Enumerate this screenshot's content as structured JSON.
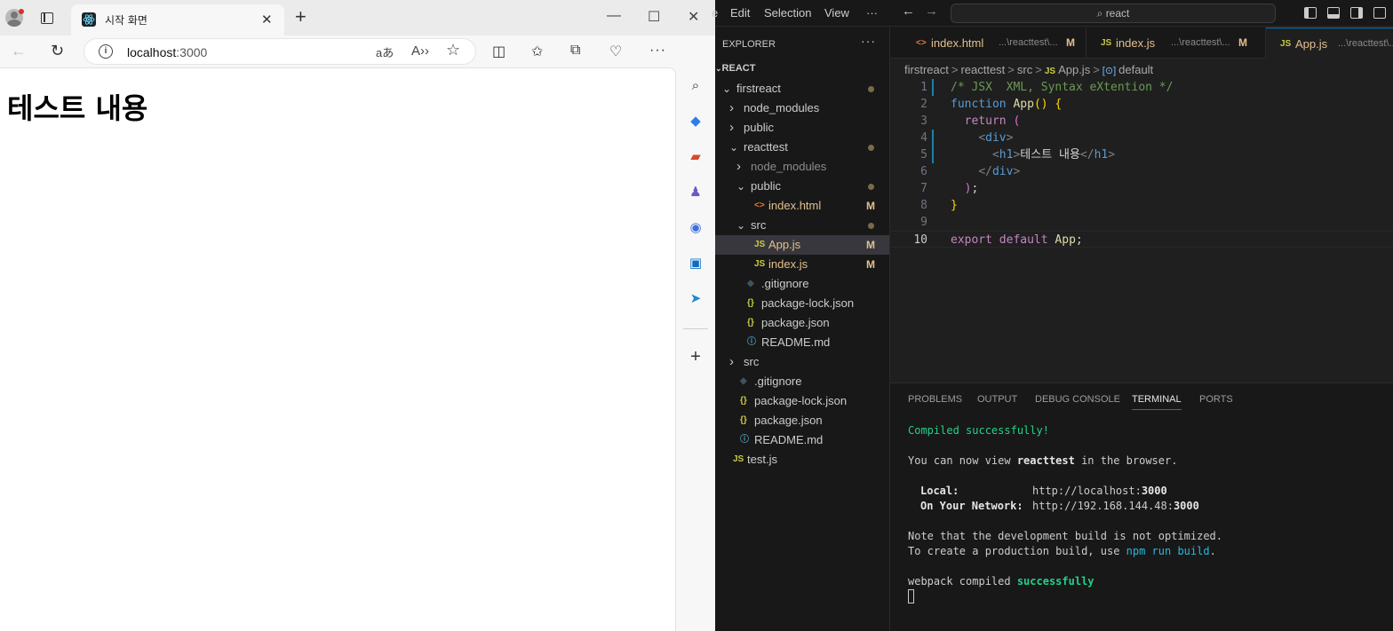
{
  "browser": {
    "tab_title": "시작 화면",
    "url_host": "localhost",
    "url_port": ":3000",
    "page_heading": "테스트 내용",
    "icons": [
      "profile-icon",
      "tab-actions-icon",
      "react-favicon",
      "close-icon",
      "new-tab-icon",
      "minimize-icon",
      "maximize-icon",
      "window-close-icon",
      "back-icon",
      "refresh-icon",
      "site-info-icon",
      "read-aloud-language-icon",
      "immersive-reader-icon",
      "favorite-star-icon",
      "split-screen-icon",
      "favorites-icon",
      "collections-icon",
      "browser-essentials-icon",
      "more-icon",
      "copilot-icon",
      "search-icon",
      "shopping-icon",
      "tools-icon",
      "games-icon",
      "microsoft-365-icon",
      "outlook-icon",
      "drop-icon",
      "add-icon"
    ]
  },
  "vscode": {
    "menu": [
      "e",
      "Edit",
      "Selection",
      "View",
      "···"
    ],
    "command_center": "react",
    "explorer_title": "EXPLORER",
    "explorer_more": "···",
    "section": "REACT",
    "tree": [
      {
        "label": "firstreact",
        "type": "folder-open",
        "depth": 0,
        "dot": true
      },
      {
        "label": "node_modules",
        "type": "folder",
        "depth": 1
      },
      {
        "label": "public",
        "type": "folder",
        "depth": 1
      },
      {
        "label": "reacttest",
        "type": "folder-open",
        "depth": 1,
        "dot": true
      },
      {
        "label": "node_modules",
        "type": "folder",
        "depth": 2,
        "dim": true
      },
      {
        "label": "public",
        "type": "folder-open",
        "depth": 2,
        "dot": true
      },
      {
        "label": "index.html",
        "type": "html",
        "depth": 3,
        "badge": "M"
      },
      {
        "label": "src",
        "type": "folder-open",
        "depth": 2,
        "dot": true
      },
      {
        "label": "App.js",
        "type": "js",
        "depth": 3,
        "badge": "M",
        "selected": true
      },
      {
        "label": "index.js",
        "type": "js",
        "depth": 3,
        "badge": "M"
      },
      {
        "label": ".gitignore",
        "type": "git",
        "depth": 2
      },
      {
        "label": "package-lock.json",
        "type": "json",
        "depth": 2
      },
      {
        "label": "package.json",
        "type": "json",
        "depth": 2
      },
      {
        "label": "README.md",
        "type": "info",
        "depth": 2
      },
      {
        "label": "src",
        "type": "folder",
        "depth": 1
      },
      {
        "label": ".gitignore",
        "type": "git",
        "depth": 1
      },
      {
        "label": "package-lock.json",
        "type": "json",
        "depth": 1
      },
      {
        "label": "package.json",
        "type": "json",
        "depth": 1
      },
      {
        "label": "README.md",
        "type": "info",
        "depth": 1
      },
      {
        "label": "test.js",
        "type": "js",
        "depth": 0
      }
    ],
    "tabs": [
      {
        "icon": "<>",
        "name": "index.html",
        "path": "...\\reacttest\\...",
        "mod": "M",
        "active": false
      },
      {
        "icon": "JS",
        "name": "index.js",
        "path": "...\\reacttest\\...",
        "mod": "M",
        "active": false
      },
      {
        "icon": "JS",
        "name": "App.js",
        "path": "...\\reacttest\\...",
        "mod": "",
        "active": true
      }
    ],
    "breadcrumb": [
      "firstreact",
      ">",
      "reacttest",
      ">",
      "src",
      ">",
      "JS",
      "App.js",
      ">",
      "[⊙]",
      "default"
    ],
    "code": [
      {
        "n": "1",
        "tokens": [
          [
            "/* JSX  XML, Syntax eXtention */",
            "#6a9955"
          ]
        ]
      },
      {
        "n": "2",
        "tokens": [
          [
            "function ",
            "#569cd6"
          ],
          [
            "App",
            "#dcdcaa"
          ],
          [
            "() ",
            "#ffd700"
          ],
          [
            "{",
            "#ffd700"
          ]
        ]
      },
      {
        "n": "3",
        "tokens": [
          [
            "  ",
            "#ccc"
          ],
          [
            "return ",
            "#c586c0"
          ],
          [
            "(",
            "#da70d6"
          ]
        ]
      },
      {
        "n": "4",
        "tokens": [
          [
            "    ",
            "#ccc"
          ],
          [
            "<",
            "#808080"
          ],
          [
            "div",
            "#569cd6"
          ],
          [
            ">",
            "#808080"
          ]
        ]
      },
      {
        "n": "5",
        "tokens": [
          [
            "      ",
            "#ccc"
          ],
          [
            "<",
            "#808080"
          ],
          [
            "h1",
            "#569cd6"
          ],
          [
            ">",
            "#808080"
          ],
          [
            "테스트 내용",
            "#d4d4d4"
          ],
          [
            "</",
            "#808080"
          ],
          [
            "h1",
            "#569cd6"
          ],
          [
            ">",
            "#808080"
          ]
        ]
      },
      {
        "n": "6",
        "tokens": [
          [
            "    ",
            "#ccc"
          ],
          [
            "</",
            "#808080"
          ],
          [
            "div",
            "#569cd6"
          ],
          [
            ">",
            "#808080"
          ]
        ]
      },
      {
        "n": "7",
        "tokens": [
          [
            "  ",
            "#ccc"
          ],
          [
            ")",
            "#da70d6"
          ],
          [
            ";",
            "#d4d4d4"
          ]
        ]
      },
      {
        "n": "8",
        "tokens": [
          [
            "}",
            "#ffd700"
          ]
        ]
      },
      {
        "n": "9",
        "tokens": []
      },
      {
        "n": "10",
        "tokens": [
          [
            "export ",
            "#c586c0"
          ],
          [
            "default ",
            "#c586c0"
          ],
          [
            "App",
            "#dcdcaa"
          ],
          [
            ";",
            "#d4d4d4"
          ]
        ]
      }
    ],
    "panel_tabs": [
      "PROBLEMS",
      "OUTPUT",
      "DEBUG CONSOLE",
      "TERMINAL",
      "PORTS"
    ],
    "terminal": {
      "compiled": "Compiled successfully!",
      "view_pre": "You can now view ",
      "view_app": "reacttest",
      "view_post": " in the browser.",
      "local_label": "Local:",
      "local_url": "http://localhost:",
      "local_port": "3000",
      "network_label": "On Your Network:",
      "network_url": "http://192.168.144.48:",
      "network_port": "3000",
      "note1": "Note that the development build is not optimized.",
      "note2_pre": "To create a production build, use ",
      "note2_cmd": "npm run build",
      "note2_post": ".",
      "webpack_pre": "webpack compiled ",
      "webpack_status": "successfully"
    },
    "colors": {
      "accent": "#0078d4",
      "modified": "#e2c08d",
      "terminal_green": "#23d18b",
      "terminal_blue": "#29b8db"
    }
  }
}
